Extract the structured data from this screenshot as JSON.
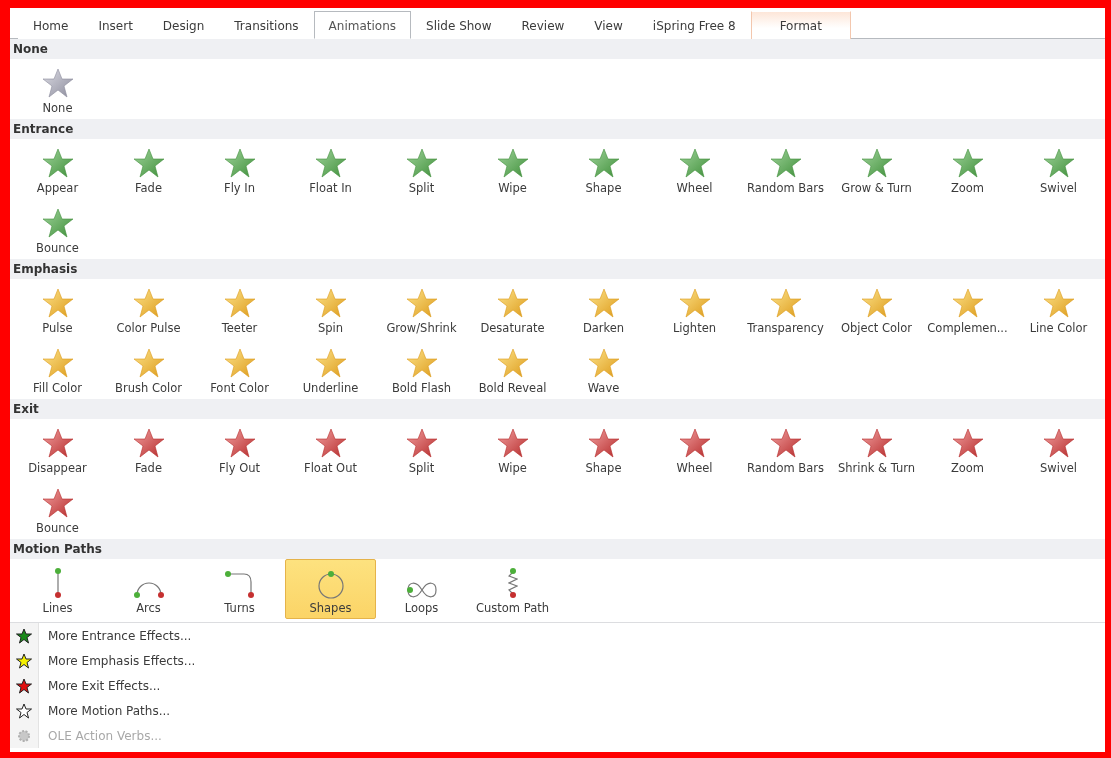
{
  "tabs": [
    {
      "label": "Home",
      "selected": false,
      "contextual": false
    },
    {
      "label": "Insert",
      "selected": false,
      "contextual": false
    },
    {
      "label": "Design",
      "selected": false,
      "contextual": false
    },
    {
      "label": "Transitions",
      "selected": false,
      "contextual": false
    },
    {
      "label": "Animations",
      "selected": true,
      "contextual": false
    },
    {
      "label": "Slide Show",
      "selected": false,
      "contextual": false
    },
    {
      "label": "Review",
      "selected": false,
      "contextual": false
    },
    {
      "label": "View",
      "selected": false,
      "contextual": false
    },
    {
      "label": "iSpring Free 8",
      "selected": false,
      "contextual": false
    },
    {
      "label": "Format",
      "selected": false,
      "contextual": true
    }
  ],
  "sections": [
    {
      "title": "None",
      "kind": "none",
      "effects": [
        {
          "label": "None",
          "selected": false
        }
      ]
    },
    {
      "title": "Entrance",
      "kind": "entrance",
      "effects": [
        {
          "label": "Appear",
          "selected": false
        },
        {
          "label": "Fade",
          "selected": false
        },
        {
          "label": "Fly In",
          "selected": false
        },
        {
          "label": "Float In",
          "selected": false
        },
        {
          "label": "Split",
          "selected": false
        },
        {
          "label": "Wipe",
          "selected": false
        },
        {
          "label": "Shape",
          "selected": false
        },
        {
          "label": "Wheel",
          "selected": false
        },
        {
          "label": "Random Bars",
          "selected": false
        },
        {
          "label": "Grow & Turn",
          "selected": false
        },
        {
          "label": "Zoom",
          "selected": false
        },
        {
          "label": "Swivel",
          "selected": false
        },
        {
          "label": "Bounce",
          "selected": false
        }
      ]
    },
    {
      "title": "Emphasis",
      "kind": "emphasis",
      "effects": [
        {
          "label": "Pulse",
          "selected": false
        },
        {
          "label": "Color Pulse",
          "selected": false
        },
        {
          "label": "Teeter",
          "selected": false
        },
        {
          "label": "Spin",
          "selected": false
        },
        {
          "label": "Grow/Shrink",
          "selected": false
        },
        {
          "label": "Desaturate",
          "selected": false
        },
        {
          "label": "Darken",
          "selected": false
        },
        {
          "label": "Lighten",
          "selected": false
        },
        {
          "label": "Transparency",
          "selected": false
        },
        {
          "label": "Object Color",
          "selected": false
        },
        {
          "label": "Complemen...",
          "selected": false
        },
        {
          "label": "Line Color",
          "selected": false
        },
        {
          "label": "Fill Color",
          "selected": false
        },
        {
          "label": "Brush Color",
          "selected": false
        },
        {
          "label": "Font Color",
          "selected": false
        },
        {
          "label": "Underline",
          "selected": false
        },
        {
          "label": "Bold Flash",
          "selected": false
        },
        {
          "label": "Bold Reveal",
          "selected": false
        },
        {
          "label": "Wave",
          "selected": false
        }
      ]
    },
    {
      "title": "Exit",
      "kind": "exit",
      "effects": [
        {
          "label": "Disappear",
          "selected": false
        },
        {
          "label": "Fade",
          "selected": false
        },
        {
          "label": "Fly Out",
          "selected": false
        },
        {
          "label": "Float Out",
          "selected": false
        },
        {
          "label": "Split",
          "selected": false
        },
        {
          "label": "Wipe",
          "selected": false
        },
        {
          "label": "Shape",
          "selected": false
        },
        {
          "label": "Wheel",
          "selected": false
        },
        {
          "label": "Random Bars",
          "selected": false
        },
        {
          "label": "Shrink & Turn",
          "selected": false
        },
        {
          "label": "Zoom",
          "selected": false
        },
        {
          "label": "Swivel",
          "selected": false
        },
        {
          "label": "Bounce",
          "selected": false
        }
      ]
    },
    {
      "title": "Motion Paths",
      "kind": "motion",
      "effects": [
        {
          "label": "Lines",
          "selected": false
        },
        {
          "label": "Arcs",
          "selected": false
        },
        {
          "label": "Turns",
          "selected": false
        },
        {
          "label": "Shapes",
          "selected": true
        },
        {
          "label": "Loops",
          "selected": false
        },
        {
          "label": "Custom Path",
          "selected": false
        }
      ]
    }
  ],
  "menu": [
    {
      "label": "More Entrance Effects...",
      "kind": "entrance",
      "disabled": false
    },
    {
      "label": "More Emphasis Effects...",
      "kind": "emphasis",
      "disabled": false
    },
    {
      "label": "More Exit Effects...",
      "kind": "exit",
      "disabled": false
    },
    {
      "label": "More Motion Paths...",
      "kind": "motion",
      "disabled": false
    },
    {
      "label": "OLE Action Verbs...",
      "kind": "ole",
      "disabled": true
    }
  ]
}
